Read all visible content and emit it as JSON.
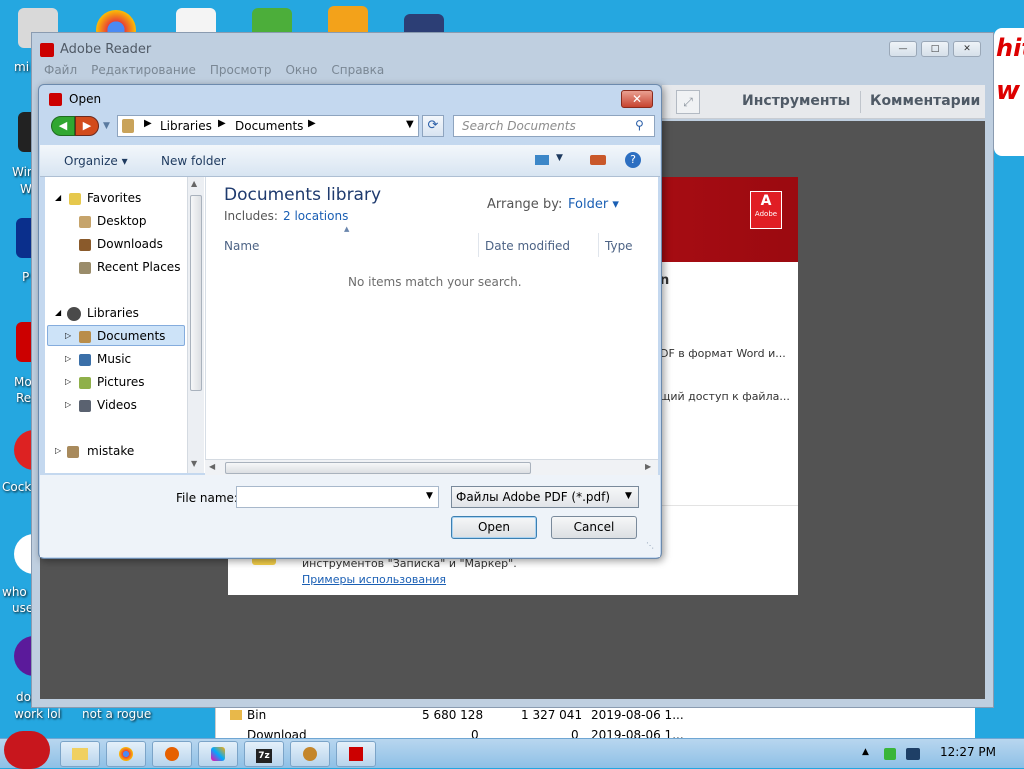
{
  "desktop": {
    "labels": [
      "mi",
      "Win",
      "W",
      "P",
      "Mo",
      "Re",
      "Cock",
      "who",
      "use",
      "do",
      "work lol",
      "not a rogue"
    ],
    "scribble": [
      "hit",
      "w"
    ]
  },
  "reader": {
    "title": "Adobe Reader",
    "menu": [
      "Файл",
      "Редактирование",
      "Просмотр",
      "Окно",
      "Справка"
    ],
    "toolbar": {
      "tools": "Инструменты",
      "comments": "Комментарии"
    },
    "logo": "Adobe",
    "panel_lines": [
      "n",
      "DF в формат Word и...",
      "щий доступ к файла...",
      "инструментов \"Записка\" и \"Маркер\".",
      "Примеры использования"
    ]
  },
  "file_manager": {
    "rows": [
      {
        "name": "Bin",
        "size": "5 680 128",
        "packed": "1 327 041",
        "date": "2019-08-06 1..."
      },
      {
        "name": "Download",
        "size": "0",
        "packed": "0",
        "date": "2019-08-06 1..."
      }
    ]
  },
  "dialog": {
    "title": "Open",
    "breadcrumb": [
      "Libraries",
      "Documents"
    ],
    "search_placeholder": "Search Documents",
    "toolbar": {
      "organize": "Organize",
      "new_folder": "New folder"
    },
    "nav": {
      "favorites": "Favorites",
      "favorite_items": [
        "Desktop",
        "Downloads",
        "Recent Places"
      ],
      "libraries": "Libraries",
      "library_items": [
        "Documents",
        "Music",
        "Pictures",
        "Videos"
      ],
      "other": "mistake"
    },
    "library_header": "Documents library",
    "includes_label": "Includes:",
    "includes_link": "2 locations",
    "arrange_label": "Arrange by:",
    "arrange_value": "Folder",
    "columns": [
      "Name",
      "Date modified",
      "Type"
    ],
    "empty_message": "No items match your search.",
    "file_name_label": "File name:",
    "file_name_value": "",
    "file_type": "Файлы Adobe PDF (*.pdf)",
    "open_button": "Open",
    "cancel_button": "Cancel"
  },
  "taskbar": {
    "clock": "12:27 PM",
    "buttons": [
      "7z"
    ]
  },
  "colors": {
    "accent": "#1a5fb4",
    "adobe_red": "#c9121a",
    "desktop_bg": "#25a7e0"
  }
}
